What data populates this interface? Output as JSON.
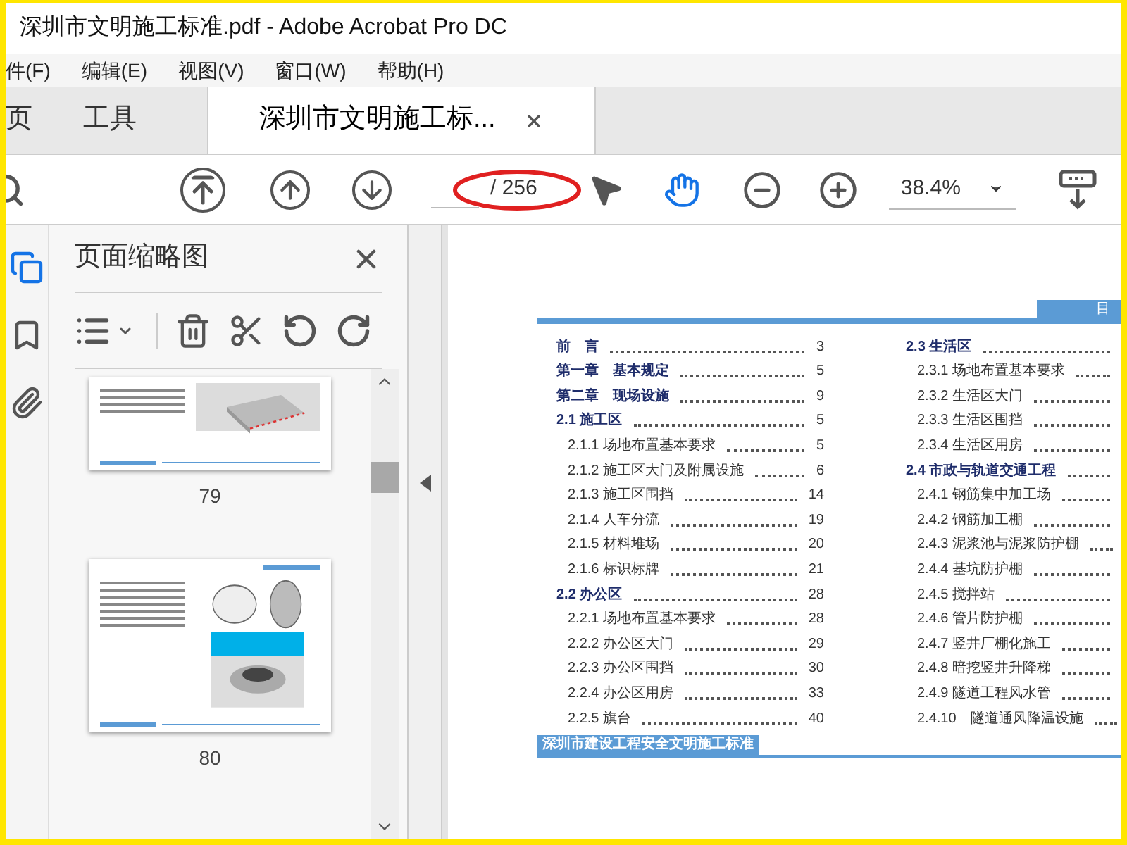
{
  "window": {
    "title": "深圳市文明施工标准.pdf - Adobe Acrobat Pro DC"
  },
  "menu": [
    "件(F)",
    "编辑(E)",
    "视图(V)",
    "窗口(W)",
    "帮助(H)"
  ],
  "tabs": [
    {
      "label": "页",
      "selected": false,
      "closable": false
    },
    {
      "label": "工具",
      "selected": false,
      "closable": false
    },
    {
      "label": "深圳市文明施工标...",
      "selected": true,
      "closable": true
    }
  ],
  "toolbar": {
    "page_total": "/ 256",
    "zoom": "38.4%",
    "tools": [
      {
        "kind": "select",
        "selected": false
      },
      {
        "kind": "hand",
        "selected": true
      }
    ]
  },
  "rail": [
    {
      "kind": "pages",
      "selected": true
    },
    {
      "kind": "bookmark",
      "selected": false
    },
    {
      "kind": "attachment",
      "selected": false
    }
  ],
  "panel": {
    "title": "页面缩略图",
    "thumbnails": [
      {
        "label": "79",
        "kind": "site"
      },
      {
        "label": "80",
        "kind": "well"
      }
    ]
  },
  "document": {
    "header_tab": "目",
    "footer": "深圳市建设工程安全文明施工标准",
    "toc_left": [
      {
        "title": "前　言",
        "page": "3"
      },
      {
        "title": "第一章　基本规定",
        "page": "5"
      },
      {
        "title": "第二章　现场设施",
        "page": "9"
      },
      {
        "title": "2.1 施工区",
        "page": "5",
        "children": [
          {
            "title": "2.1.1 场地布置基本要求",
            "page": "5"
          },
          {
            "title": "2.1.2 施工区大门及附属设施",
            "page": "6"
          },
          {
            "title": "2.1.3 施工区围挡",
            "page": "14"
          },
          {
            "title": "2.1.4 人车分流",
            "page": "19"
          },
          {
            "title": "2.1.5 材料堆场",
            "page": "20"
          },
          {
            "title": "2.1.6 标识标牌",
            "page": "21"
          }
        ]
      },
      {
        "title": "2.2 办公区",
        "page": "28",
        "children": [
          {
            "title": "2.2.1 场地布置基本要求",
            "page": "28"
          },
          {
            "title": "2.2.2 办公区大门",
            "page": "29"
          },
          {
            "title": "2.2.3 办公区围挡",
            "page": "30"
          },
          {
            "title": "2.2.4 办公区用房",
            "page": "33"
          },
          {
            "title": "2.2.5 旗台",
            "page": "40"
          }
        ]
      }
    ],
    "toc_right": [
      {
        "title": "2.3 生活区",
        "children": [
          {
            "title": "2.3.1 场地布置基本要求"
          },
          {
            "title": "2.3.2 生活区大门"
          },
          {
            "title": "2.3.3 生活区围挡"
          },
          {
            "title": "2.3.4 生活区用房"
          }
        ]
      },
      {
        "title": "2.4 市政与轨道交通工程",
        "children": [
          {
            "title": "2.4.1 钢筋集中加工场"
          },
          {
            "title": "2.4.2 钢筋加工棚"
          },
          {
            "title": "2.4.3 泥浆池与泥浆防护棚"
          },
          {
            "title": "2.4.4 基坑防护棚"
          },
          {
            "title": "2.4.5 搅拌站"
          },
          {
            "title": "2.4.6 管片防护棚"
          },
          {
            "title": "2.4.7 竖井厂棚化施工"
          },
          {
            "title": "2.4.8 暗挖竖井升降梯"
          },
          {
            "title": "2.4.9 隧道工程风水管"
          },
          {
            "title": "2.4.10　隧道通风降温设施"
          }
        ]
      }
    ]
  }
}
